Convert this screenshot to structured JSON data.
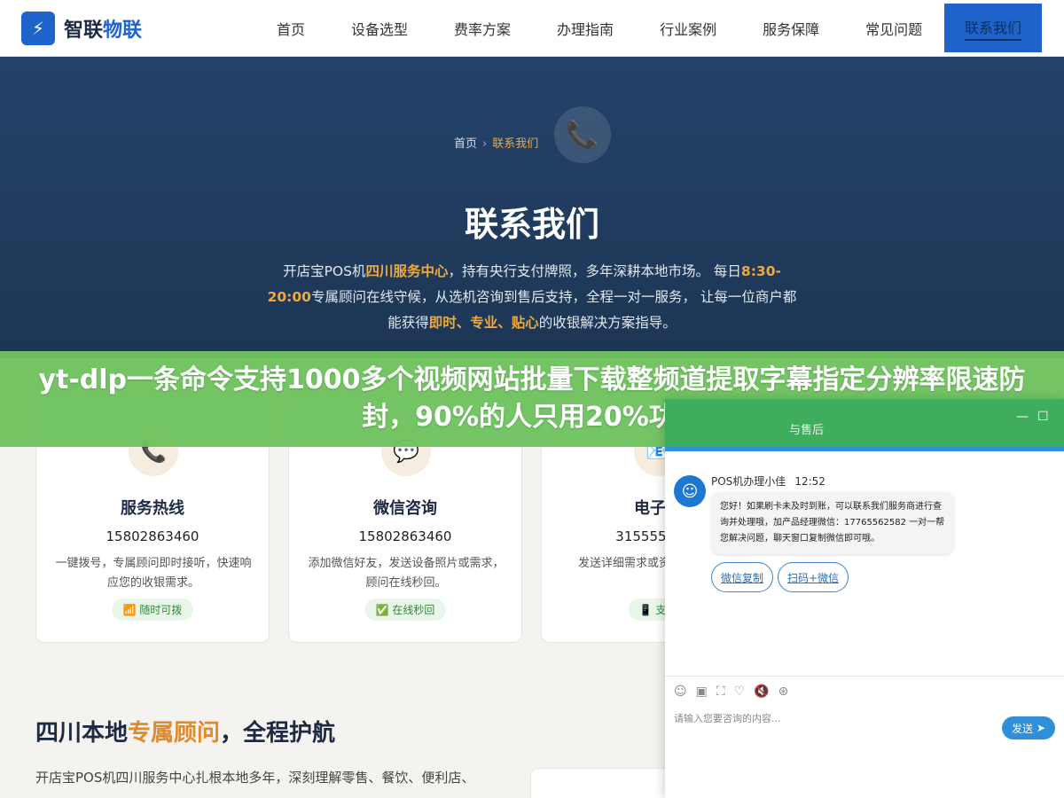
{
  "nav": {
    "logo_mark": "⚡",
    "logo_text_a": "智联",
    "logo_text_b": "物联",
    "items": [
      "首页",
      "设备选型",
      "费率方案",
      "办理指南",
      "行业案例",
      "服务保障",
      "常见问题"
    ],
    "active": "联系我们"
  },
  "hero": {
    "crumb_home": "首页",
    "crumb_sep": "›",
    "crumb_current": "联系我们",
    "phone_icon": "📞",
    "title": "联系我们",
    "desc_1": "开店宝POS机",
    "desc_2": "四川服务中心",
    "desc_3": "，持有央行支付牌照，多年深耕本地市场。 每日",
    "desc_4": "8:30-20:00",
    "desc_5": "专属顾问在线守候，从选机咨询到售后支持，全程一对一服务， 让每一位商户都能获得",
    "desc_6": "即时、专业、贴心",
    "desc_7": "的收银解决方案指导。"
  },
  "banner": {
    "text": "yt-dlp一条命令支持1000多个视频网站批量下载整频道提取字幕指定分辨率限速防封，90%的人只用20%功能"
  },
  "cards": [
    {
      "icon": "📞",
      "title": "服务热线",
      "num": "15802863460",
      "desc": "一键拨号，专属顾问即时接听，快速响应您的收银需求。",
      "badge": "📶 随时可拨"
    },
    {
      "icon": "💬",
      "title": "微信咨询",
      "num": "15802863460",
      "desc": "添加微信好友，发送设备照片或需求，顾问在线秒回。",
      "badge": "✅ 在线秒回"
    },
    {
      "icon": "📧",
      "title": "电子邮",
      "num": "3155555535",
      "desc": "发送详细需求或资料复，支持附",
      "badge": "📱 支持"
    }
  ],
  "section": {
    "title_a": "四川本地",
    "title_b": "专属顾问",
    "title_c": "，全程护航",
    "p1": "开店宝POS机四川服务中心扎根本地多年，深刻理解零售、餐饮、便利店、"
  },
  "chat": {
    "header_title": "与售后",
    "min_icon": "—",
    "max_icon": "☐",
    "agent_name": "POS机办理小佳",
    "time": "12:52",
    "avatar_icon": "☺",
    "message": "您好！如果刷卡未及时到账，可以联系我们服务商进行查询并处理哦，加产品经理微信：17765562582 一对一帮您解决问题，聊天窗口复制微信即可哦。",
    "btn_copy": "微信复制",
    "btn_scan": "扫码+微信",
    "tools": [
      "☺",
      "▣",
      "⛶",
      "♡",
      "🔇",
      "⊛"
    ],
    "input_placeholder": "请输入您要咨询的内容...",
    "send": "发送",
    "send_icon": "➤"
  }
}
